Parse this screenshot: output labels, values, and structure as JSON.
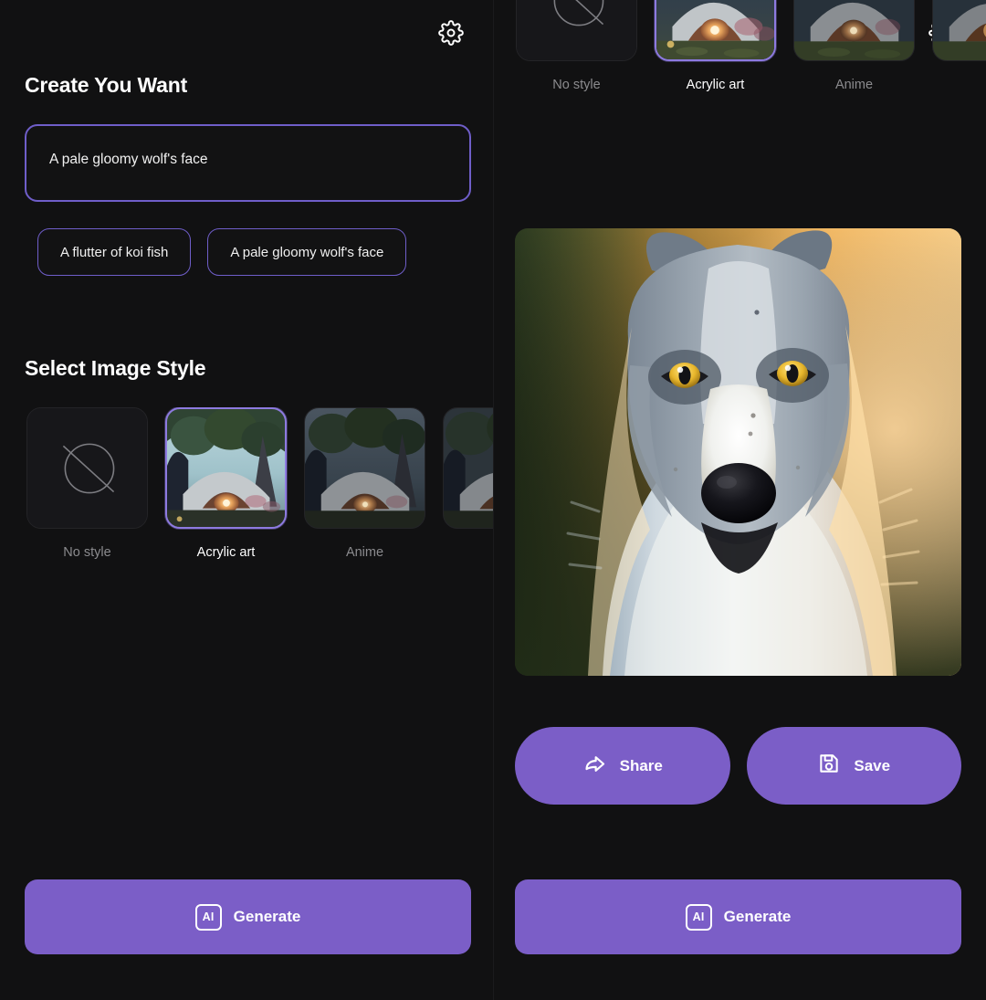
{
  "app": {
    "background_color": "#0d0d0e",
    "accent_color": "#7b5ec7",
    "border_accent_color": "#6f5ec9"
  },
  "settings": {
    "icon": "gear-icon",
    "label": "Settings"
  },
  "left_panel": {
    "heading_create": "Create You Want",
    "prompt": {
      "value": "A pale gloomy wolf's face",
      "placeholder": "A pale gloomy wolf's face"
    },
    "suggestions": [
      {
        "label": "A flutter of koi fish"
      },
      {
        "label": "A pale gloomy wolf's face"
      }
    ],
    "heading_style": "Select Image Style",
    "generate_label": "Generate",
    "generate_badge": "AI"
  },
  "styles": [
    {
      "label": "No style",
      "selected": false,
      "thumb": "none"
    },
    {
      "label": "Acrylic art",
      "selected": true,
      "thumb": "landscape-bright"
    },
    {
      "label": "Anime",
      "selected": false,
      "thumb": "landscape-dim"
    },
    {
      "label": "",
      "selected": false,
      "thumb": "landscape-dim"
    }
  ],
  "right_panel": {
    "result_image_alt": "Generated wolf face portrait",
    "share_label": "Share",
    "save_label": "Save",
    "generate_label": "Generate",
    "generate_badge": "AI"
  }
}
